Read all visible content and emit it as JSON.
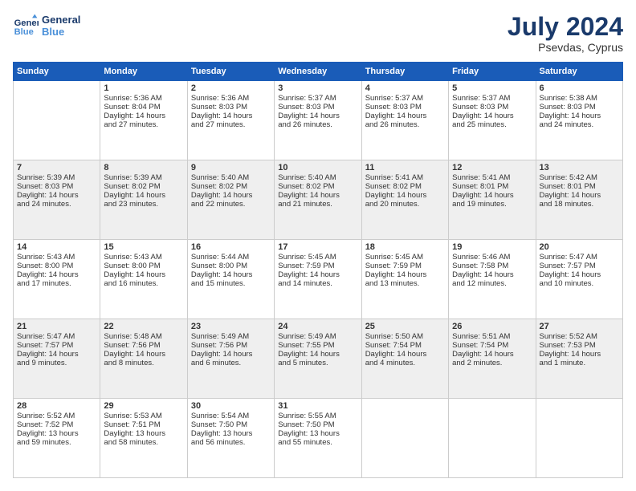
{
  "header": {
    "logo_general": "General",
    "logo_blue": "Blue",
    "month_year": "July 2024",
    "location": "Psevdas, Cyprus"
  },
  "days_of_week": [
    "Sunday",
    "Monday",
    "Tuesday",
    "Wednesday",
    "Thursday",
    "Friday",
    "Saturday"
  ],
  "weeks": [
    [
      {
        "day": "",
        "info": ""
      },
      {
        "day": "1",
        "info": "Sunrise: 5:36 AM\nSunset: 8:04 PM\nDaylight: 14 hours\nand 27 minutes."
      },
      {
        "day": "2",
        "info": "Sunrise: 5:36 AM\nSunset: 8:03 PM\nDaylight: 14 hours\nand 27 minutes."
      },
      {
        "day": "3",
        "info": "Sunrise: 5:37 AM\nSunset: 8:03 PM\nDaylight: 14 hours\nand 26 minutes."
      },
      {
        "day": "4",
        "info": "Sunrise: 5:37 AM\nSunset: 8:03 PM\nDaylight: 14 hours\nand 26 minutes."
      },
      {
        "day": "5",
        "info": "Sunrise: 5:37 AM\nSunset: 8:03 PM\nDaylight: 14 hours\nand 25 minutes."
      },
      {
        "day": "6",
        "info": "Sunrise: 5:38 AM\nSunset: 8:03 PM\nDaylight: 14 hours\nand 24 minutes."
      }
    ],
    [
      {
        "day": "7",
        "info": "Sunrise: 5:39 AM\nSunset: 8:03 PM\nDaylight: 14 hours\nand 24 minutes."
      },
      {
        "day": "8",
        "info": "Sunrise: 5:39 AM\nSunset: 8:02 PM\nDaylight: 14 hours\nand 23 minutes."
      },
      {
        "day": "9",
        "info": "Sunrise: 5:40 AM\nSunset: 8:02 PM\nDaylight: 14 hours\nand 22 minutes."
      },
      {
        "day": "10",
        "info": "Sunrise: 5:40 AM\nSunset: 8:02 PM\nDaylight: 14 hours\nand 21 minutes."
      },
      {
        "day": "11",
        "info": "Sunrise: 5:41 AM\nSunset: 8:02 PM\nDaylight: 14 hours\nand 20 minutes."
      },
      {
        "day": "12",
        "info": "Sunrise: 5:41 AM\nSunset: 8:01 PM\nDaylight: 14 hours\nand 19 minutes."
      },
      {
        "day": "13",
        "info": "Sunrise: 5:42 AM\nSunset: 8:01 PM\nDaylight: 14 hours\nand 18 minutes."
      }
    ],
    [
      {
        "day": "14",
        "info": "Sunrise: 5:43 AM\nSunset: 8:00 PM\nDaylight: 14 hours\nand 17 minutes."
      },
      {
        "day": "15",
        "info": "Sunrise: 5:43 AM\nSunset: 8:00 PM\nDaylight: 14 hours\nand 16 minutes."
      },
      {
        "day": "16",
        "info": "Sunrise: 5:44 AM\nSunset: 8:00 PM\nDaylight: 14 hours\nand 15 minutes."
      },
      {
        "day": "17",
        "info": "Sunrise: 5:45 AM\nSunset: 7:59 PM\nDaylight: 14 hours\nand 14 minutes."
      },
      {
        "day": "18",
        "info": "Sunrise: 5:45 AM\nSunset: 7:59 PM\nDaylight: 14 hours\nand 13 minutes."
      },
      {
        "day": "19",
        "info": "Sunrise: 5:46 AM\nSunset: 7:58 PM\nDaylight: 14 hours\nand 12 minutes."
      },
      {
        "day": "20",
        "info": "Sunrise: 5:47 AM\nSunset: 7:57 PM\nDaylight: 14 hours\nand 10 minutes."
      }
    ],
    [
      {
        "day": "21",
        "info": "Sunrise: 5:47 AM\nSunset: 7:57 PM\nDaylight: 14 hours\nand 9 minutes."
      },
      {
        "day": "22",
        "info": "Sunrise: 5:48 AM\nSunset: 7:56 PM\nDaylight: 14 hours\nand 8 minutes."
      },
      {
        "day": "23",
        "info": "Sunrise: 5:49 AM\nSunset: 7:56 PM\nDaylight: 14 hours\nand 6 minutes."
      },
      {
        "day": "24",
        "info": "Sunrise: 5:49 AM\nSunset: 7:55 PM\nDaylight: 14 hours\nand 5 minutes."
      },
      {
        "day": "25",
        "info": "Sunrise: 5:50 AM\nSunset: 7:54 PM\nDaylight: 14 hours\nand 4 minutes."
      },
      {
        "day": "26",
        "info": "Sunrise: 5:51 AM\nSunset: 7:54 PM\nDaylight: 14 hours\nand 2 minutes."
      },
      {
        "day": "27",
        "info": "Sunrise: 5:52 AM\nSunset: 7:53 PM\nDaylight: 14 hours\nand 1 minute."
      }
    ],
    [
      {
        "day": "28",
        "info": "Sunrise: 5:52 AM\nSunset: 7:52 PM\nDaylight: 13 hours\nand 59 minutes."
      },
      {
        "day": "29",
        "info": "Sunrise: 5:53 AM\nSunset: 7:51 PM\nDaylight: 13 hours\nand 58 minutes."
      },
      {
        "day": "30",
        "info": "Sunrise: 5:54 AM\nSunset: 7:50 PM\nDaylight: 13 hours\nand 56 minutes."
      },
      {
        "day": "31",
        "info": "Sunrise: 5:55 AM\nSunset: 7:50 PM\nDaylight: 13 hours\nand 55 minutes."
      },
      {
        "day": "",
        "info": ""
      },
      {
        "day": "",
        "info": ""
      },
      {
        "day": "",
        "info": ""
      }
    ]
  ]
}
